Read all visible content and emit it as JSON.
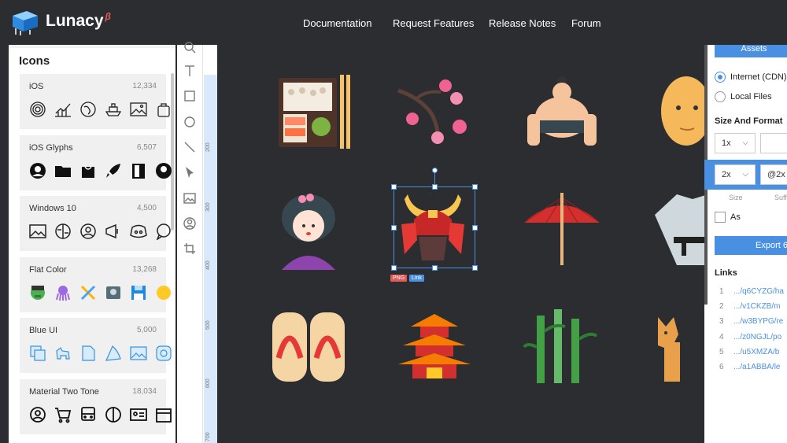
{
  "brand": {
    "name": "Lunacy",
    "beta": "β"
  },
  "nav": [
    "Documentation",
    "Request Features",
    "Release Notes",
    "Forum"
  ],
  "icons_panel": {
    "title": "Icons",
    "collections": [
      {
        "name": "iOS",
        "count": "12,334",
        "icons": [
          "fingerprint-icon",
          "chart-icon",
          "globe-icon",
          "ship-icon",
          "image-icon",
          "bag-icon"
        ]
      },
      {
        "name": "iOS Glyphs",
        "count": "6,507",
        "icons": [
          "user-icon",
          "folder-icon",
          "shopping-bag-icon",
          "rocket-icon",
          "door-icon",
          "user-icon"
        ]
      },
      {
        "name": "Windows 10",
        "count": "4,500",
        "icons": [
          "image-icon",
          "brain-icon",
          "person-icon",
          "megaphone-icon",
          "discord-icon",
          "chat-icon"
        ]
      },
      {
        "name": "Flat Color",
        "count": "13,268",
        "icons": [
          "hulk-icon",
          "octopus-icon",
          "crossed-tools-icon",
          "hard-drive-icon",
          "floppy-icon",
          "emoji-icon"
        ]
      },
      {
        "name": "Blue UI",
        "count": "5,000",
        "icons": [
          "copy-icon",
          "dog-icon",
          "file-icon",
          "pizza-icon",
          "picture-icon",
          "instagram-icon"
        ]
      },
      {
        "name": "Material Two Tone",
        "count": "18,034",
        "icons": [
          "account-icon",
          "cart-icon",
          "bus-icon",
          "brain-icon",
          "id-card-icon",
          "calendar-icon"
        ]
      }
    ]
  },
  "ruler": {
    "labels": [
      "200",
      "300",
      "400",
      "500",
      "600",
      "700"
    ]
  },
  "canvas": {
    "selected_badges": {
      "png": "PNG",
      "link": "Link"
    }
  },
  "export_panel": {
    "assets_button": "Assets",
    "source_options": [
      {
        "label": "Internet (CDN)",
        "selected": true
      },
      {
        "label": "Local Files",
        "selected": false
      }
    ],
    "size_format_title": "Size And Format",
    "row1": {
      "size": "1x",
      "suffix": ""
    },
    "row2": {
      "size": "2x",
      "suffix": "@2x"
    },
    "size_label": "Size",
    "suffix_label": "Suff",
    "as_label": "As",
    "export_button": "Export 6",
    "links_title": "Links",
    "links": [
      {
        "n": "1",
        "url": ".../q6CYZG/ha"
      },
      {
        "n": "2",
        "url": ".../v1CKZB/m"
      },
      {
        "n": "3",
        "url": ".../w3BYPG/re"
      },
      {
        "n": "4",
        "url": ".../z0NGJL/po"
      },
      {
        "n": "5",
        "url": ".../u5XMZA/b"
      },
      {
        "n": "6",
        "url": ".../a1ABBA/le"
      }
    ]
  },
  "colors": {
    "accent": "#4a90e2",
    "dark_bg": "#2b2d31",
    "beta": "#e25a57"
  }
}
